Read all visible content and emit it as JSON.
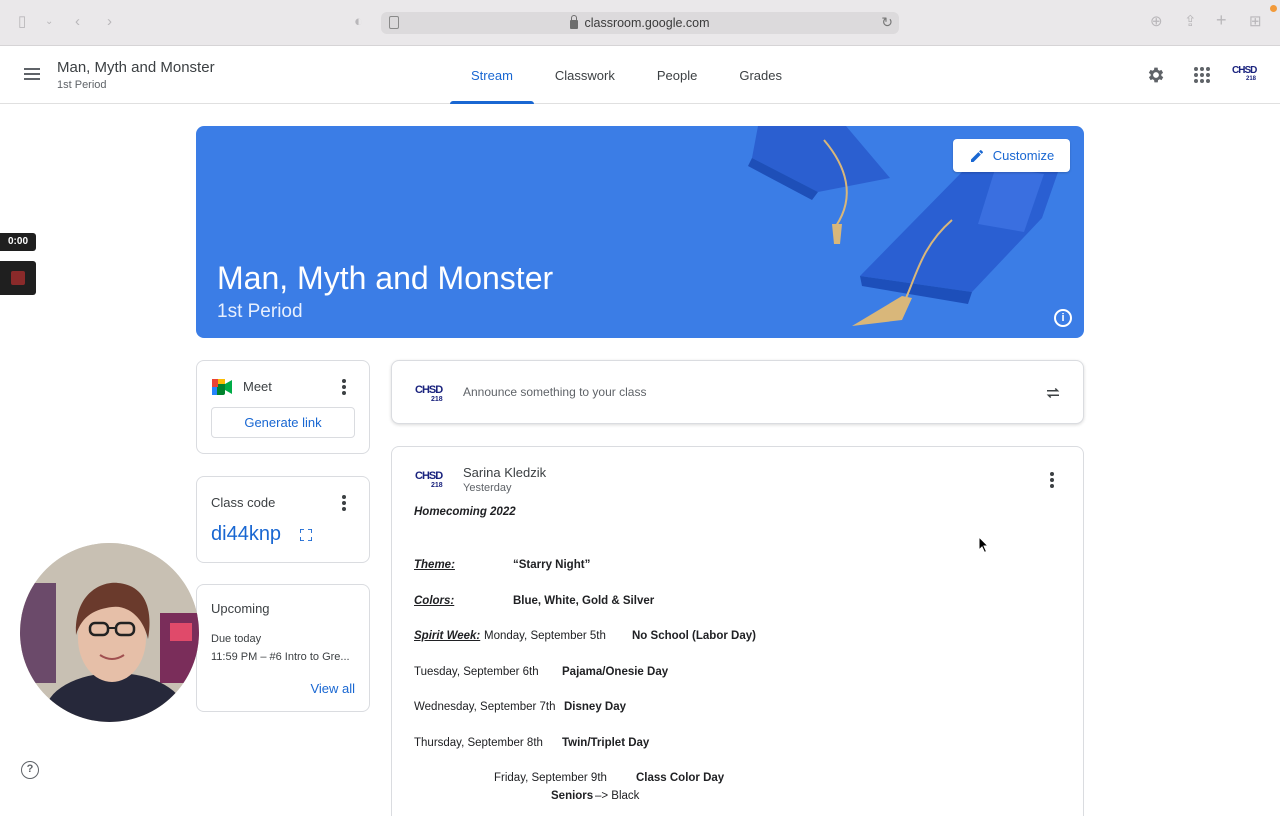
{
  "browser": {
    "url": "classroom.google.com"
  },
  "header": {
    "class_name": "Man, Myth and Monster",
    "section": "1st Period",
    "tabs": [
      "Stream",
      "Classwork",
      "People",
      "Grades"
    ],
    "active_tab": "Stream"
  },
  "banner": {
    "title": "Man, Myth and Monster",
    "subtitle": "1st Period",
    "customize_label": "Customize",
    "color": "#3b7de6"
  },
  "meet": {
    "label": "Meet",
    "generate_link_label": "Generate link"
  },
  "class_code": {
    "label": "Class code",
    "code": "di44knp"
  },
  "upcoming": {
    "title": "Upcoming",
    "due": "Due today",
    "item": "11:59 PM – #6 Intro to Gre...",
    "view_all": "View all"
  },
  "announce": {
    "placeholder": "Announce something to your class"
  },
  "post": {
    "author": "Sarina Kledzik",
    "time": "Yesterday",
    "heading": "Homecoming 2022",
    "theme_label": "Theme:",
    "theme_value": "“Starry Night”",
    "colors_label": "Colors:",
    "colors_value": "Blue, White, Gold & Silver",
    "spirit_label": "Spirit Week:",
    "days": [
      {
        "date": "Monday, September 5th",
        "event": "No School (Labor Day)"
      },
      {
        "date": "Tuesday, September 6th",
        "event": "Pajama/Onesie Day"
      },
      {
        "date": "Wednesday, September 7th",
        "event": "Disney Day"
      },
      {
        "date": "Thursday, September 8th",
        "event": "Twin/Triplet Day"
      },
      {
        "date": "Friday, September 9th",
        "event": "Class Color Day"
      }
    ],
    "seniors_label": "Seniors",
    "seniors_value": "–> Black"
  },
  "school_logo": {
    "top": "CHSD",
    "bottom": "218"
  },
  "recording": {
    "time": "0:00"
  }
}
